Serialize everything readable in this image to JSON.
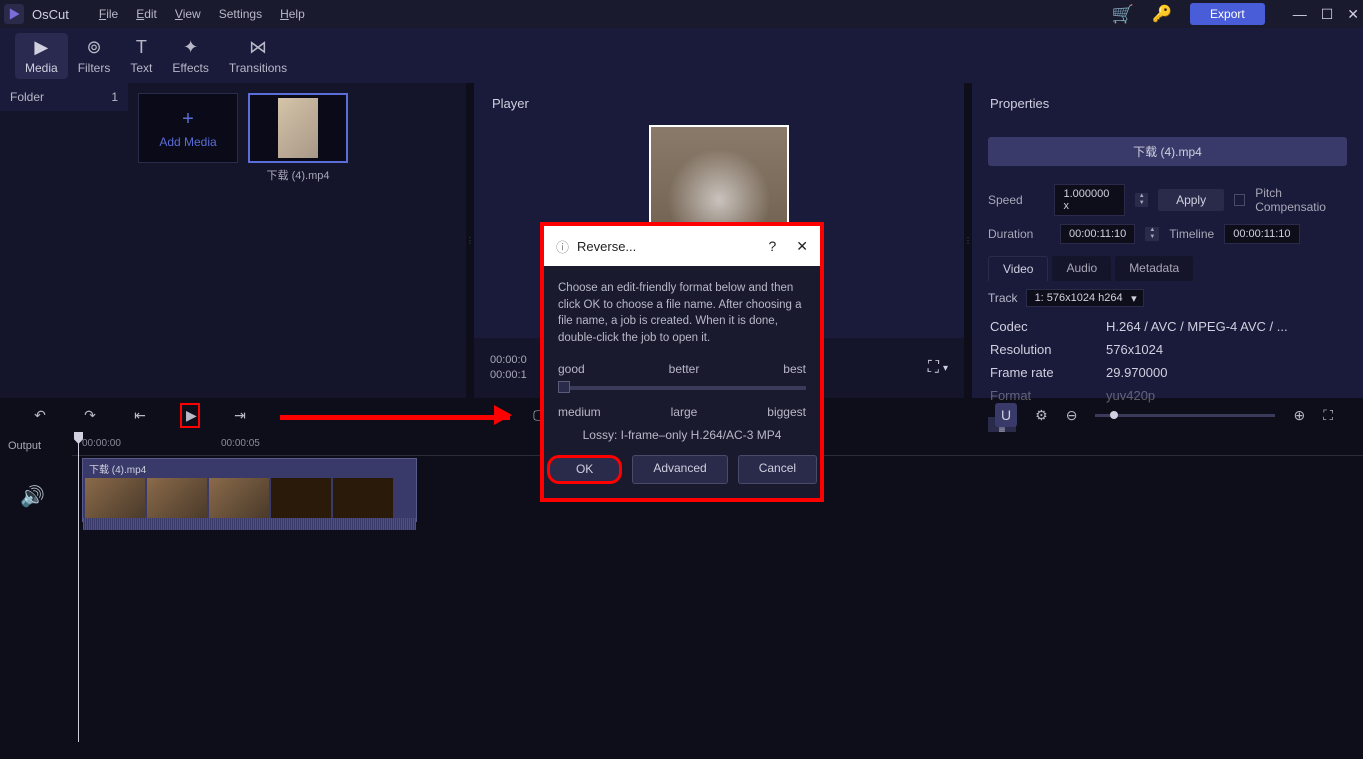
{
  "app": {
    "name": "OsCut"
  },
  "menu": {
    "file": "File",
    "edit": "Edit",
    "view": "View",
    "settings": "Settings",
    "help": "Help"
  },
  "titlebar": {
    "export": "Export"
  },
  "tools": {
    "media": "Media",
    "filters": "Filters",
    "text": "Text",
    "effects": "Effects",
    "transitions": "Transitions"
  },
  "folder": {
    "label": "Folder",
    "count": "1"
  },
  "addMedia": "Add Media",
  "mediaItem": "下载 (4).mp4",
  "player": {
    "title": "Player",
    "time1": "00:00:0",
    "time2": "00:00:1"
  },
  "props": {
    "title": "Properties",
    "file": "下载 (4).mp4",
    "speedLabel": "Speed",
    "speedVal": "1.000000 x",
    "apply": "Apply",
    "pitch": "Pitch Compensatio",
    "durationLabel": "Duration",
    "durationVal": "00:00:11:10",
    "timelineLabel": "Timeline",
    "timelineVal": "00:00:11:10",
    "tabs": {
      "video": "Video",
      "audio": "Audio",
      "metadata": "Metadata"
    },
    "trackLabel": "Track",
    "trackVal": "1: 576x1024 h264",
    "codecLabel": "Codec",
    "codecVal": "H.264 / AVC / MPEG-4 AVC / ...",
    "resLabel": "Resolution",
    "resVal": "576x1024",
    "fpsLabel": "Frame rate",
    "fpsVal": "29.970000",
    "fmtLabel": "Format",
    "fmtVal": "yuv420p"
  },
  "timeline": {
    "output": "Output",
    "ruler": {
      "t0": "00:00:00",
      "t5": "00:00:05"
    },
    "clipName": "下载 (4).mp4"
  },
  "dialog": {
    "title": "Reverse...",
    "body": "Choose an edit-friendly format below and then click OK to choose a file name. After choosing a file name, a job is created. When it is done, double-click the job to open it.",
    "q1": {
      "a": "good",
      "b": "better",
      "c": "best"
    },
    "q2": {
      "a": "medium",
      "b": "large",
      "c": "biggest"
    },
    "format": "Lossy: I-frame–only H.264/AC-3 MP4",
    "ok": "OK",
    "advanced": "Advanced",
    "cancel": "Cancel"
  }
}
